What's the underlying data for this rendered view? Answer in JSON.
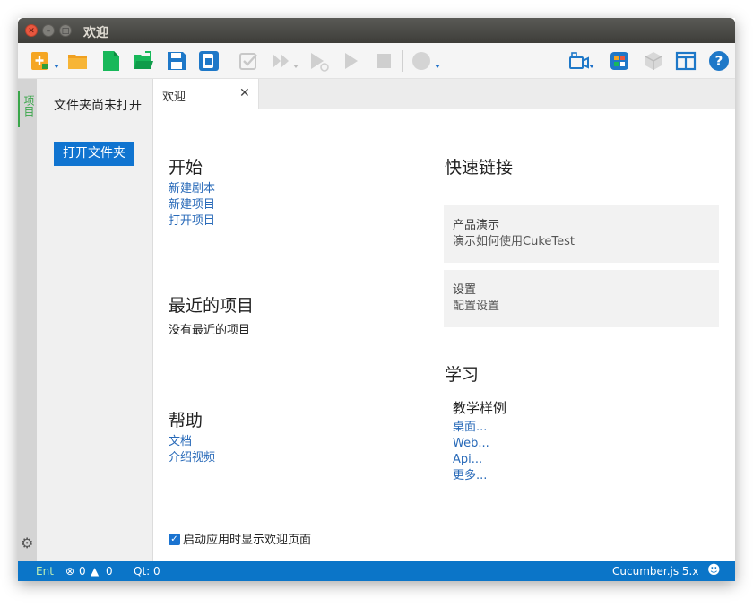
{
  "window": {
    "title": "欢迎"
  },
  "toolbar": {
    "icons": [
      "new-script-icon",
      "open-folder-icon",
      "new-file-icon",
      "open-file-icon",
      "save-icon",
      "save-all-icon",
      "check-icon",
      "run-all-icon",
      "run-debug-icon",
      "run-icon",
      "stop-icon",
      "record-icon",
      "camera-icon",
      "palette-icon",
      "cube-icon",
      "layout-icon",
      "help-icon"
    ],
    "accent": "#1e70c8"
  },
  "activity": {
    "project_tab": "项目"
  },
  "sidebar": {
    "message": "文件夹尚未打开",
    "open_button": "打开文件夹"
  },
  "tab": {
    "label": "欢迎",
    "close": "✕"
  },
  "welcome": {
    "start": {
      "heading": "开始",
      "links": [
        "新建剧本",
        "新建项目",
        "打开项目"
      ]
    },
    "recent": {
      "heading": "最近的项目",
      "empty": "没有最近的项目"
    },
    "help": {
      "heading": "帮助",
      "links": [
        "文档",
        "介绍视频"
      ]
    },
    "quick": {
      "heading": "快速链接",
      "cards": [
        {
          "title": "产品演示",
          "desc": "演示如何使用CukeTest"
        },
        {
          "title": "设置",
          "desc": "配置设置"
        }
      ]
    },
    "learn": {
      "heading": "学习",
      "subheading": "教学样例",
      "links": [
        "桌面...",
        "Web...",
        "Api...",
        "更多..."
      ]
    },
    "show_on_startup": {
      "label": "启动应用时显示欢迎页面",
      "checked": true
    }
  },
  "status": {
    "ent": "Ent",
    "errors": "0",
    "warnings": "0",
    "qt": "Qt: 0",
    "runtime": "Cucumber.js 5.x",
    "color": "#0b75c8"
  }
}
